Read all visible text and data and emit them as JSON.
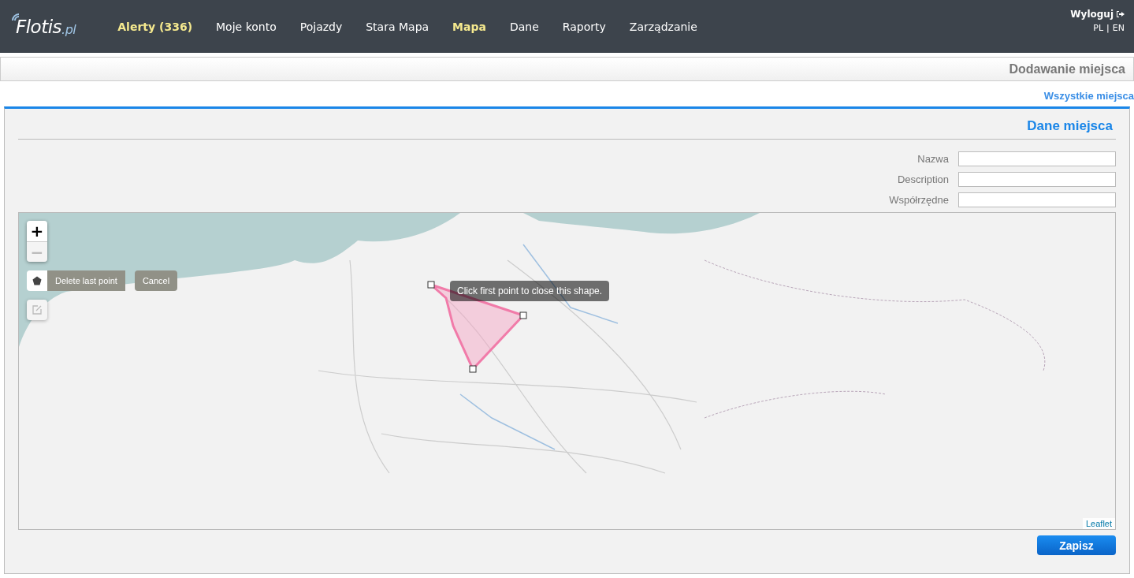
{
  "header": {
    "logo": {
      "name": "Flotis",
      "suffix": ".pl"
    },
    "nav": [
      {
        "label": "Alerty (336)",
        "highlighted": true
      },
      {
        "label": "Moje konto",
        "highlighted": false
      },
      {
        "label": "Pojazdy",
        "highlighted": false
      },
      {
        "label": "Stara Mapa",
        "highlighted": false
      },
      {
        "label": "Mapa",
        "highlighted": true
      },
      {
        "label": "Dane",
        "highlighted": false
      },
      {
        "label": "Raporty",
        "highlighted": false
      },
      {
        "label": "Zarządzanie",
        "highlighted": false
      }
    ],
    "logout": "Wyloguj",
    "languages": [
      "PL",
      "|",
      "EN"
    ]
  },
  "page_title": "Dodawanie miejsca",
  "all_places_link": "Wszystkie miejsca",
  "panel": {
    "title": "Dane miejsca",
    "fields": [
      {
        "label": "Nazwa"
      },
      {
        "label": "Description"
      },
      {
        "label": "Współrzędne"
      }
    ],
    "map": {
      "zoom": [
        {
          "label": "+",
          "disabled": false
        },
        {
          "label": "−",
          "disabled": true
        }
      ],
      "draw_actions": [
        "Delete last point",
        "Cancel"
      ],
      "edit_disabled": true,
      "tooltip": "Click first point to close this shape.",
      "attribution": "Leaflet"
    },
    "save_button": "Zapisz"
  }
}
